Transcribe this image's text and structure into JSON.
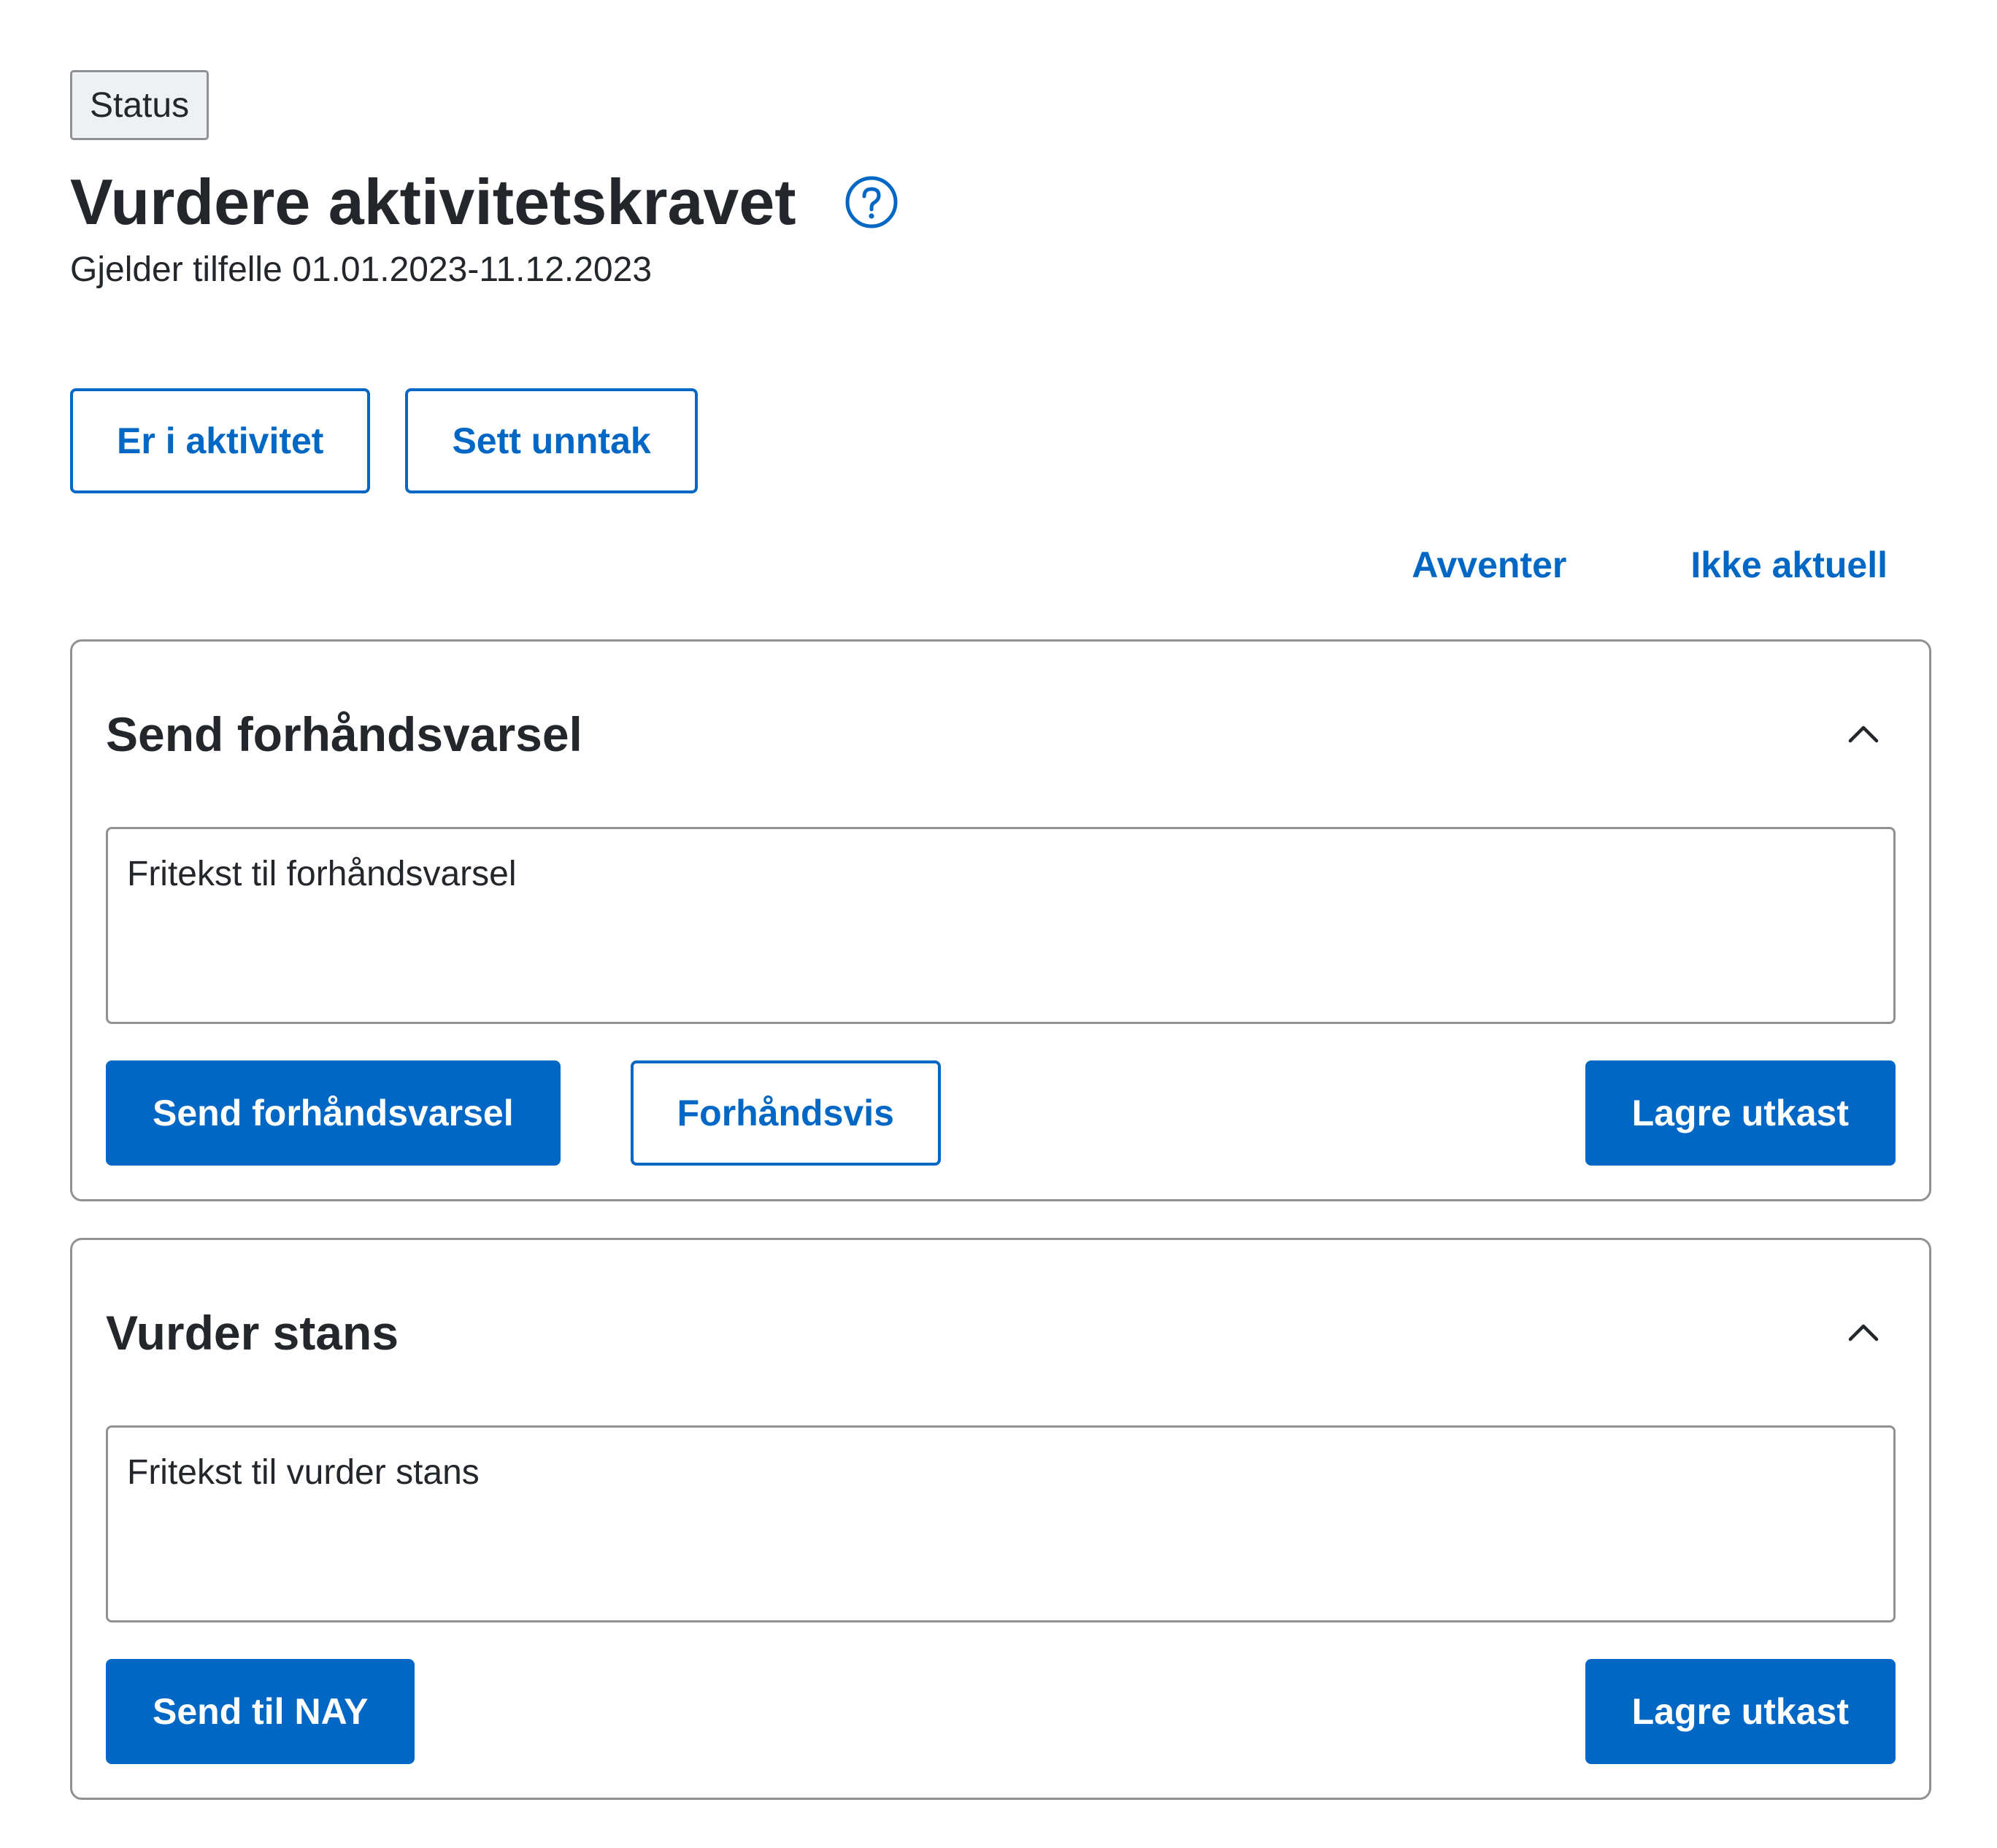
{
  "status_tag": "Status",
  "header": {
    "title": "Vurdere aktivitetskravet",
    "subtitle": "Gjelder tilfelle 01.01.2023-11.12.2023",
    "help_icon": "question-circle-icon"
  },
  "actions": {
    "er_i_aktivitet": "Er i aktivitet",
    "sett_unntak": "Sett unntak"
  },
  "links": {
    "avventer": "Avventer",
    "ikke_aktuell": "Ikke aktuell"
  },
  "forhandsvarsel": {
    "title": "Send forhåndsvarsel",
    "textarea_value": "",
    "textarea_placeholder": "Fritekst til forhåndsvarsel",
    "send_label": "Send forhåndsvarsel",
    "preview_label": "Forhåndsvis",
    "save_label": "Lagre utkast",
    "chevron_icon": "chevron-up-icon"
  },
  "vurder_stans": {
    "title": "Vurder stans",
    "textarea_value": "",
    "textarea_placeholder": "Fritekst til vurder stans",
    "send_label": "Send til NAY",
    "save_label": "Lagre utkast",
    "chevron_icon": "chevron-up-icon"
  },
  "colors": {
    "primary": "#0067c5",
    "text": "#23262a",
    "border": "#8f9195",
    "tag_background": "#eff0f2"
  }
}
